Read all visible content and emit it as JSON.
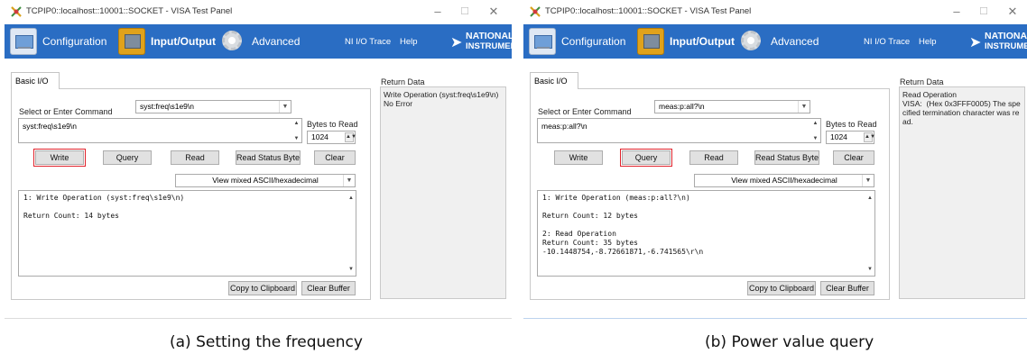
{
  "panels": [
    {
      "window_title": "TCPIP0::localhost::10001::SOCKET - VISA Test Panel",
      "nav": {
        "configuration": "Configuration",
        "input_output": "Input/Output",
        "advanced": "Advanced",
        "io_trace": "NI I/O Trace",
        "help": "Help",
        "logo_line1": "NATIONAL",
        "logo_line2": "INSTRUMENTS"
      },
      "tab": "Basic I/O",
      "command_label": "Select or Enter Command",
      "command_selected": "syst:freq\\s1e9\\n",
      "command_text": "syst:freq\\s1e9\\n",
      "bytes_label": "Bytes to Read",
      "bytes_value": "1024",
      "buttons": {
        "write": "Write",
        "query": "Query",
        "read": "Read",
        "status": "Read Status Byte",
        "clear": "Clear"
      },
      "highlighted_button": "write",
      "view_mode": "View mixed ASCII/hexadecimal",
      "output_lines": [
        "1: Write Operation (syst:freq\\s1e9\\n)",
        "",
        "Return Count: 14 bytes"
      ],
      "copy_label": "Copy to Clipboard",
      "clear_buffer_label": "Clear Buffer",
      "return_label": "Return Data",
      "return_lines": [
        "Write Operation (syst:freq\\s1e9\\n)",
        "No Error"
      ]
    },
    {
      "window_title": "TCPIP0::localhost::10001::SOCKET - VISA Test Panel",
      "nav": {
        "configuration": "Configuration",
        "input_output": "Input/Output",
        "advanced": "Advanced",
        "io_trace": "NI I/O Trace",
        "help": "Help",
        "logo_line1": "NATIONAL",
        "logo_line2": "INSTRUMENTS"
      },
      "tab": "Basic I/O",
      "command_label": "Select or Enter Command",
      "command_selected": "meas:p:all?\\n",
      "command_text": "meas:p:all?\\n",
      "bytes_label": "Bytes to Read",
      "bytes_value": "1024",
      "buttons": {
        "write": "Write",
        "query": "Query",
        "read": "Read",
        "status": "Read Status Byte",
        "clear": "Clear"
      },
      "highlighted_button": "query",
      "view_mode": "View mixed ASCII/hexadecimal",
      "output_lines": [
        "1: Write Operation (meas:p:all?\\n)",
        "",
        "Return Count: 12 bytes",
        "",
        "2: Read Operation",
        "Return Count: 35 bytes",
        "-10.1448754,-8.72661871,-6.741565\\r\\n"
      ],
      "copy_label": "Copy to Clipboard",
      "clear_buffer_label": "Clear Buffer",
      "return_label": "Return Data",
      "return_lines": [
        "Read Operation",
        "VISA:  (Hex 0x3FFF0005) The specified termination character was read."
      ]
    }
  ],
  "captions": [
    "(a) Setting the frequency",
    "(b) Power value query"
  ],
  "colors": {
    "navbar": "#2a6dc3",
    "highlight": "#e0232c",
    "return_panel": "#f0f0f0"
  }
}
